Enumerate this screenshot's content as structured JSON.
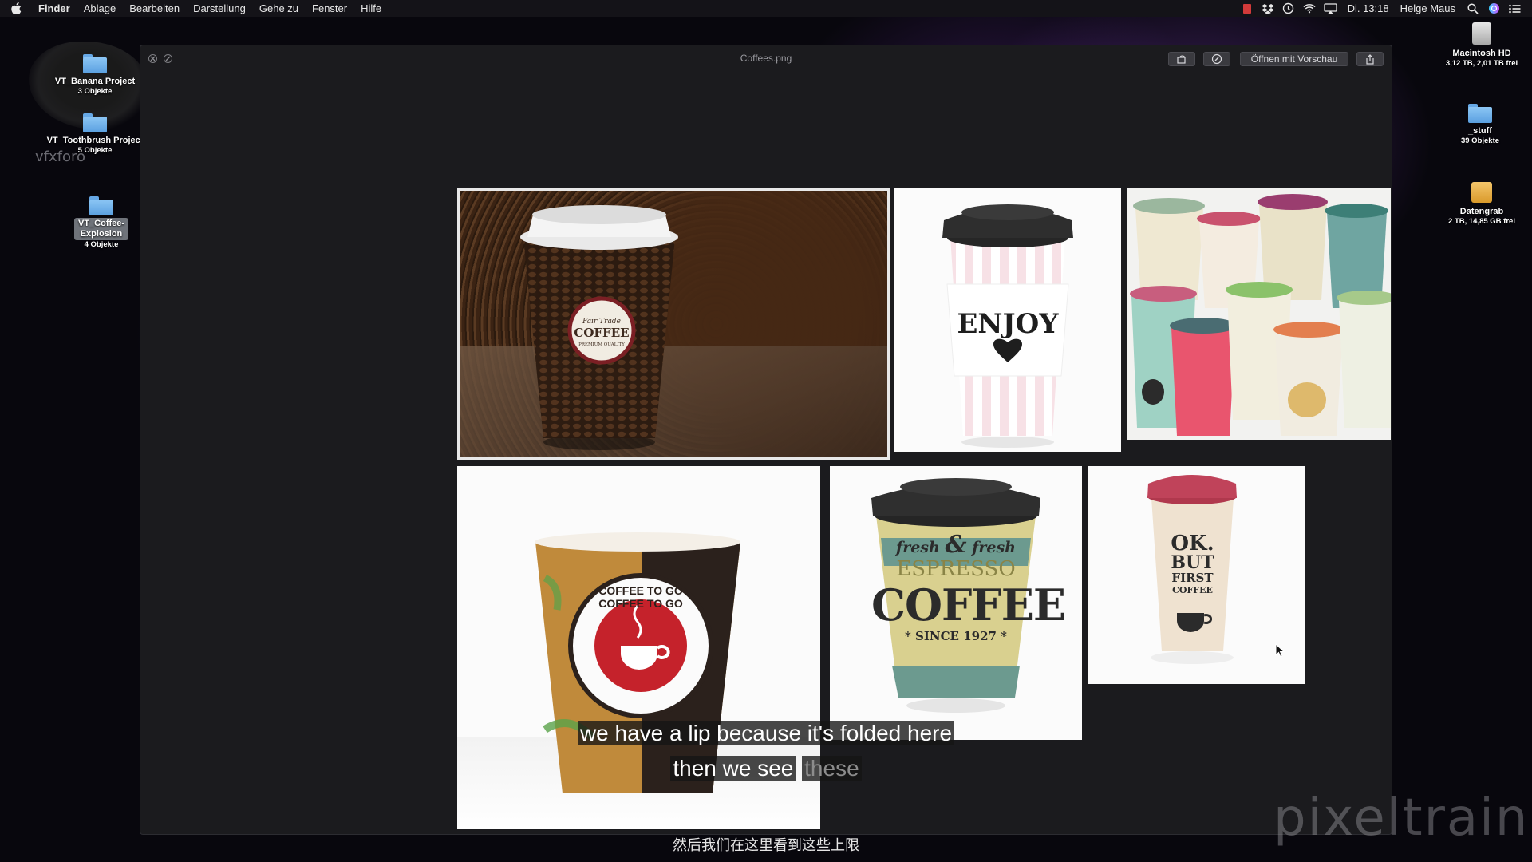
{
  "menubar": {
    "items": [
      "Finder",
      "Ablage",
      "Bearbeiten",
      "Darstellung",
      "Gehe zu",
      "Fenster",
      "Hilfe"
    ],
    "clock": "Di. 13:18",
    "user": "Helge Maus",
    "status_icons": [
      "red-app-icon",
      "dropbox-icon",
      "time-machine-icon",
      "wifi-icon",
      "airplay-icon"
    ]
  },
  "desktop": {
    "left_icons": [
      {
        "label": "VT_Banana Project",
        "sub": "3 Objekte"
      },
      {
        "label": "VT_Toothbrush Project",
        "sub": "5 Objekte"
      },
      {
        "label": "VT_Coffee-Explosion",
        "sub": "4 Objekte"
      }
    ],
    "right_icons": [
      {
        "label": "Macintosh HD",
        "sub": "3,12 TB, 2,01 TB frei"
      },
      {
        "label": "_stuff",
        "sub": "39 Objekte"
      },
      {
        "label": "Datengrab",
        "sub": "2 TB, 14,85 GB frei"
      }
    ],
    "watermark_small": "vfxforo"
  },
  "quicklook": {
    "title": "Coffees.png",
    "open_button": "Öffnen mit Vorschau",
    "images": {
      "beans": {
        "brand_line1": "Fair Trade",
        "brand_line2": "COFFEE",
        "brand_line3": "PREMIUM QUALITY"
      },
      "enjoy": {
        "text": "ENJOY"
      },
      "togo": {
        "ring_text": "COFFEE TO GO COFFEE TO GO"
      },
      "espresso": {
        "line1": "fresh",
        "amp": "&",
        "line2": "fresh",
        "line3": "ESPRESSO",
        "line4": "COFFEE",
        "line5": "* SINCE 1927 *"
      },
      "okbut": {
        "line1": "OK.",
        "line2": "BUT",
        "line3": "FIRST",
        "line4": "COFFEE"
      }
    }
  },
  "subtitles": {
    "line1": "we have a lip because it's folded here",
    "line2a": "then we see",
    "line2b": "these",
    "chinese": "然后我们在这里看到这些上限"
  },
  "branding": {
    "watermark": "pixeltrain"
  },
  "colors": {
    "menubar": "#141318",
    "window": "#1b1b1e",
    "folder": "#6fb2ee"
  }
}
